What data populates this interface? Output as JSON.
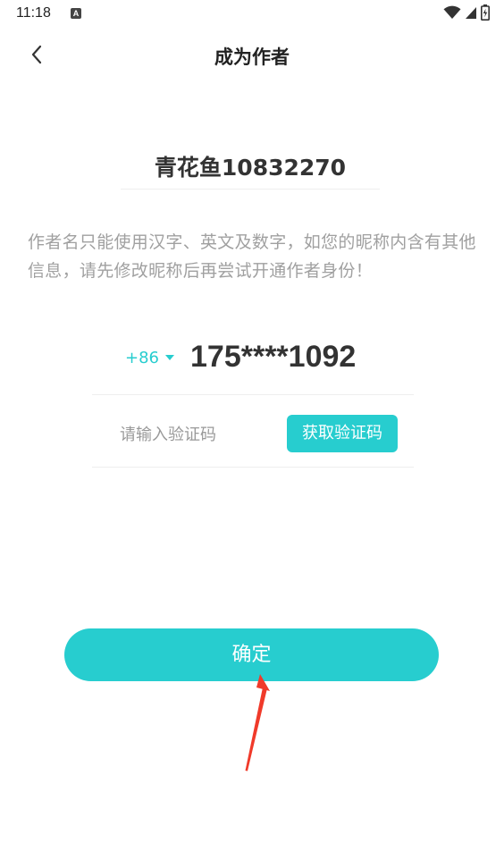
{
  "status_bar": {
    "time": "11:18",
    "a_icon_label": "A",
    "icons": [
      "wifi-icon",
      "signal-icon",
      "battery-icon"
    ]
  },
  "header": {
    "back_icon": "chevron-left-icon",
    "title": "成为作者"
  },
  "author": {
    "name": "青花鱼10832270"
  },
  "tip": {
    "text": "作者名只能使用汉字、英文及数字，如您的昵称内含有其他信息，请先修改昵称后再尝试开通作者身份！"
  },
  "phone": {
    "country_code": "+86",
    "number": "175****1092"
  },
  "verification": {
    "placeholder": "请输入验证码",
    "value": "",
    "get_code_label": "获取验证码"
  },
  "confirm": {
    "label": "确定"
  },
  "colors": {
    "accent": "#27cdcf",
    "annotation_arrow": "#f03a2a",
    "tip_text": "#a0a0a0",
    "divider": "#eeeeee"
  }
}
